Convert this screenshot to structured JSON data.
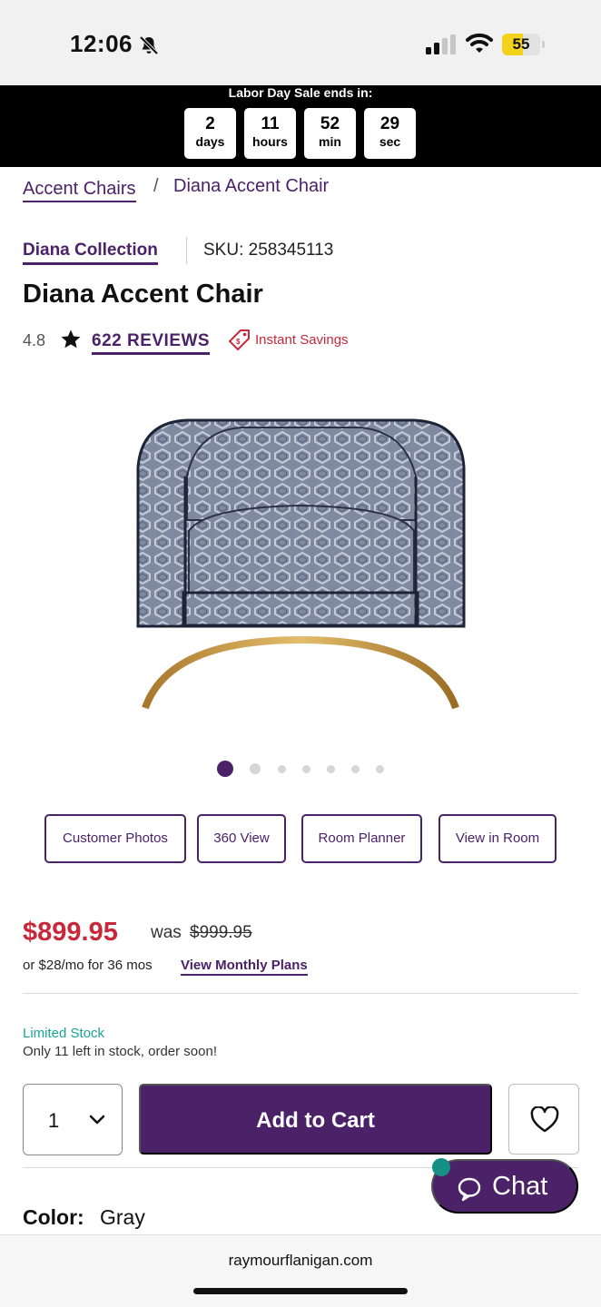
{
  "status_bar": {
    "time": "12:06",
    "battery": "55",
    "battery_level": 0.55
  },
  "sale_banner": {
    "title": "Labor Day Sale ends in:",
    "countdown": [
      {
        "value": "2",
        "unit": "days"
      },
      {
        "value": "11",
        "unit": "hours"
      },
      {
        "value": "52",
        "unit": "min"
      },
      {
        "value": "29",
        "unit": "sec"
      }
    ]
  },
  "breadcrumb": {
    "parent": "Accent Chairs",
    "separator": "/",
    "current": "Diana Accent Chair"
  },
  "product": {
    "collection": "Diana Collection",
    "sku": "SKU: 258345113",
    "title": "Diana Accent Chair",
    "rating": "4.8",
    "reviews": "622 REVIEWS",
    "promo": "Instant Savings",
    "image_icon": "accent-chair",
    "carousel": {
      "count": 7,
      "active_index": 0
    }
  },
  "feature_buttons": [
    {
      "label": "Customer Photos"
    },
    {
      "label": "360 View"
    },
    {
      "label": "Room Planner"
    },
    {
      "label": "View in Room"
    }
  ],
  "pricing": {
    "price": "$899.95",
    "was_label": "was",
    "was_price": "$999.95",
    "monthly": "or $28/mo for 36 mos",
    "monthly_link": "View Monthly Plans"
  },
  "stock": {
    "status": "Limited Stock",
    "note": "Only 11 left in stock, order soon!"
  },
  "purchase": {
    "quantity": "1",
    "add_to_cart": "Add to Cart"
  },
  "color": {
    "label": "Color:",
    "value": "Gray"
  },
  "chat": {
    "label": "Chat"
  },
  "browser": {
    "url": "raymourflanigan.com"
  },
  "colors": {
    "brand_purple": "#4b2168",
    "sale_red": "#c8283a",
    "stock_teal": "#1aa39a"
  }
}
